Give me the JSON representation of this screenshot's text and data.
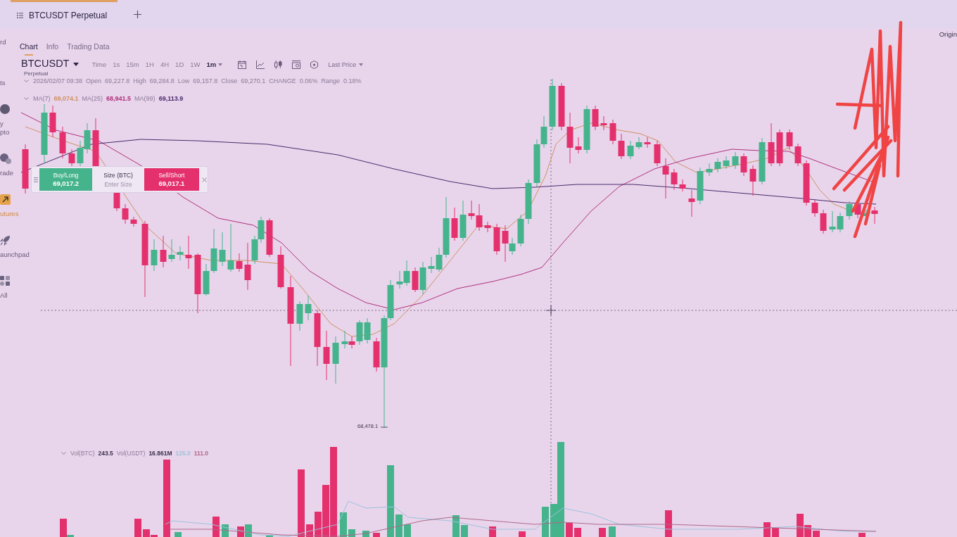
{
  "tabs": [
    {
      "label": "BTCUSDT Perpetual",
      "selected": true
    }
  ],
  "sidebar": {
    "items": [
      {
        "kind": "text",
        "lines": [
          "rd"
        ],
        "selected": false
      },
      {
        "kind": "text",
        "lines": [
          "ts"
        ],
        "selected": false
      },
      {
        "kind": "coin",
        "lines": [
          "y",
          "pto"
        ],
        "selected": false
      },
      {
        "kind": "trade",
        "lines": [
          "rade"
        ],
        "selected": false
      },
      {
        "kind": "futures",
        "lines": [
          "utures"
        ],
        "selected": true
      },
      {
        "kind": "rocket",
        "lines": [
          "aunchpad"
        ],
        "selected": false
      },
      {
        "kind": "grid",
        "lines": [
          "All"
        ],
        "selected": false
      }
    ]
  },
  "view_tabs": [
    {
      "label": "Chart",
      "selected": true
    },
    {
      "label": "Info",
      "selected": false
    },
    {
      "label": "Trading Data",
      "selected": false
    }
  ],
  "corner_label": "Origin",
  "toolbar": {
    "symbol": "BTCUSDT",
    "contract": "Perpetual",
    "intervals": [
      {
        "label": "Time",
        "selected": false,
        "dropdown": false
      },
      {
        "label": "1s",
        "selected": false,
        "dropdown": false
      },
      {
        "label": "15m",
        "selected": false,
        "dropdown": false
      },
      {
        "label": "1H",
        "selected": false,
        "dropdown": false
      },
      {
        "label": "4H",
        "selected": false,
        "dropdown": false
      },
      {
        "label": "1D",
        "selected": false,
        "dropdown": false
      },
      {
        "label": "1W",
        "selected": false,
        "dropdown": false
      },
      {
        "label": "1m",
        "selected": true,
        "dropdown": true
      }
    ],
    "price_type": "Last Price"
  },
  "chart": {
    "legend": {
      "time": "2026/02/07 09:38",
      "fields": [
        {
          "label": "Open",
          "value": "69,227.8"
        },
        {
          "label": "High",
          "value": "69,284.8"
        },
        {
          "label": "Low",
          "value": "69,157.8"
        },
        {
          "label": "Close",
          "value": "69,270.1"
        },
        {
          "label": "CHANGE",
          "value": "0.06%"
        },
        {
          "label": "Range",
          "value": "0.18%"
        }
      ]
    },
    "ma_legend": [
      {
        "label": "MA(7)",
        "value": "69,074.1",
        "color": "#d0915e"
      },
      {
        "label": "MA(25)",
        "value": "68,941.5",
        "color": "#b0307a"
      },
      {
        "label": "MA(99)",
        "value": "69,113.9",
        "color": "#4a2a6a"
      }
    ],
    "order_widget": {
      "buy": {
        "label": "Buy/Long",
        "price": "69,017.2"
      },
      "size": {
        "label": "Size (BTC)",
        "placeholder": "Enter Size"
      },
      "sell": {
        "label": "Sell/Short",
        "price": "69,017.1"
      }
    },
    "low_price_label": "68,478.1",
    "volume_legend": [
      {
        "label": "Vol(BTC)",
        "value": "243.5",
        "color": "#3a3048"
      },
      {
        "label": "Vol(USDT)",
        "value": "16.861M",
        "color": "#3a3048"
      },
      {
        "value": "125.0",
        "color": "#9cc2da"
      },
      {
        "value": "111.0",
        "color": "#b06888"
      }
    ]
  }
}
